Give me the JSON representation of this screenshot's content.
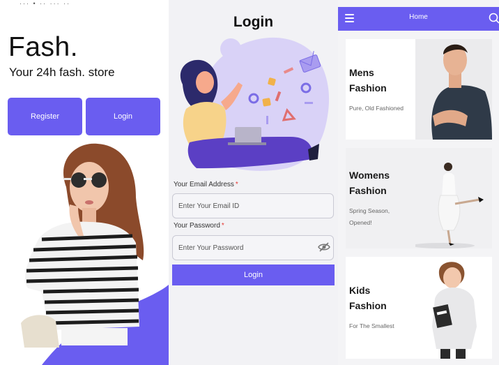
{
  "welcome": {
    "status_text": "··· •   ·· ··· ··",
    "brand": "Fash.",
    "tagline": "Your 24h fash. store",
    "register_label": "Register",
    "login_label": "Login"
  },
  "login": {
    "title": "Login",
    "email_label": "Your Email Address",
    "email_placeholder": "Enter Your Email ID",
    "email_value": "",
    "password_label": "Your Password",
    "password_placeholder": "Enter Your Password",
    "password_value": "",
    "required_mark": "*",
    "button_label": "Login"
  },
  "home": {
    "title": "Home",
    "cards": [
      {
        "title_line1": "Mens",
        "title_line2": "Fashion",
        "sub_line1": "Pure,  Old Fashioned",
        "sub_line2": ""
      },
      {
        "title_line1": "Womens",
        "title_line2": "Fashion",
        "sub_line1": "Spring Season,",
        "sub_line2": "Opened!"
      },
      {
        "title_line1": "Kids",
        "title_line2": "Fashion",
        "sub_line1": "For The Smallest",
        "sub_line2": ""
      }
    ]
  },
  "colors": {
    "accent": "#6a5df0",
    "accent_light": "#d9d2f7",
    "required": "#e53935"
  },
  "icons": [
    "menu-icon",
    "search-icon",
    "eye-off-icon"
  ]
}
